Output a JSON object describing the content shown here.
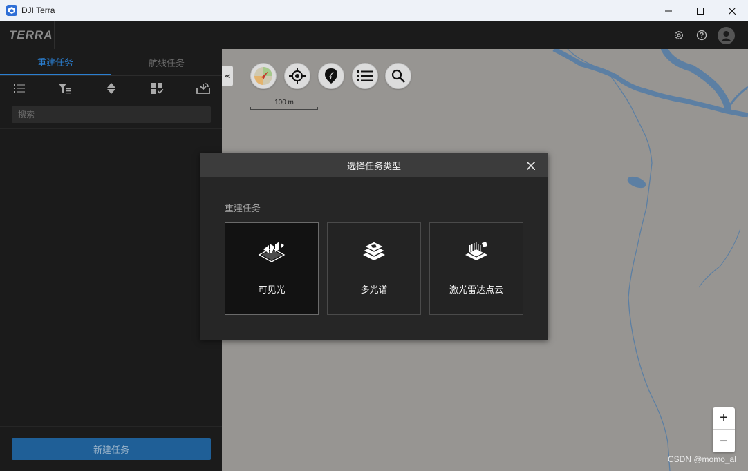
{
  "window": {
    "title": "DJI Terra"
  },
  "header": {
    "logo": "TERRA"
  },
  "sidebar": {
    "tabs": [
      {
        "label": "重建任务",
        "active": true
      },
      {
        "label": "航线任务",
        "active": false
      }
    ],
    "toolbar": [
      "list-icon",
      "filter-icon",
      "sort-icon",
      "select-icon",
      "import-icon"
    ],
    "search_placeholder": "搜索",
    "new_task_label": "新建任务"
  },
  "map": {
    "scale_label": "100 m",
    "watermark": "CSDN @momo_al",
    "zoom_in": "+",
    "zoom_out": "−"
  },
  "modal": {
    "title": "选择任务类型",
    "section_label": "重建任务",
    "cards": [
      {
        "label": "可见光",
        "icon": "visible-light-icon",
        "selected": true
      },
      {
        "label": "多光谱",
        "icon": "multispectral-icon",
        "selected": false
      },
      {
        "label": "激光雷达点云",
        "icon": "lidar-pointcloud-icon",
        "selected": false
      }
    ]
  },
  "colors": {
    "accent": "#2b7fd1",
    "button": "#1f5f97",
    "map": "#979592",
    "river": "#5c7fa3"
  }
}
